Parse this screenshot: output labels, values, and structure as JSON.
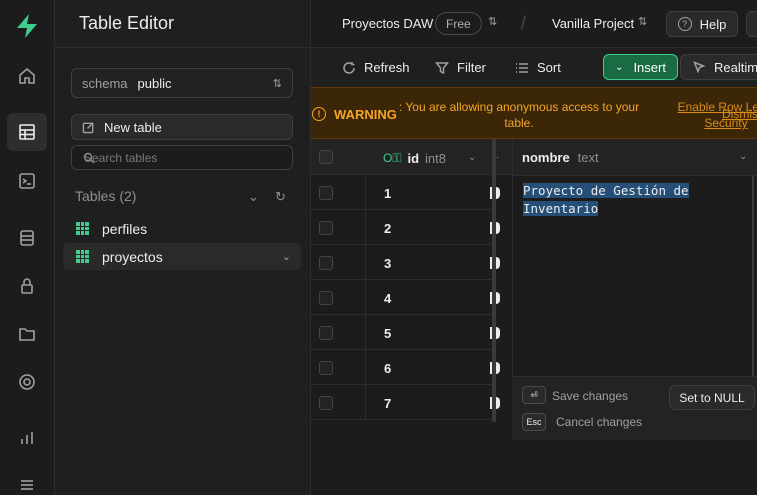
{
  "sidebar": {
    "title": "Table Editor",
    "schema_label": "schema",
    "schema_value": "public",
    "new_table_label": "New table",
    "search_placeholder": "Search tables",
    "tables_heading": "Tables (2)",
    "tables": [
      {
        "name": "perfiles",
        "selected": false
      },
      {
        "name": "proyectos",
        "selected": true
      }
    ]
  },
  "rail": {
    "icons": [
      "home-icon",
      "table-editor-icon",
      "sql-editor-icon",
      "database-icon",
      "auth-icon",
      "storage-icon",
      "realtime-icon",
      "reports-icon",
      "logs-icon"
    ],
    "active": "table-editor-icon",
    "accent": "#3ecf8e"
  },
  "topbar": {
    "project": "Proyectos DAW",
    "plan": "Free",
    "separator": "/",
    "branch": "Vanilla Project",
    "help_label": "Help"
  },
  "toolbar": {
    "refresh_label": "Refresh",
    "filter_label": "Filter",
    "sort_label": "Sort",
    "insert_label": "Insert",
    "realtime_label": "Realtime"
  },
  "warning": {
    "title": "WARNING",
    "message": ": You are allowing anonymous access to your table.",
    "link": "Enable Row Level Security",
    "dismiss": "Dismiss",
    "color": "#f5a524"
  },
  "grid": {
    "id_column": {
      "name": "id",
      "type": "int8"
    },
    "rows": [
      "1",
      "2",
      "3",
      "4",
      "5",
      "6",
      "7"
    ]
  },
  "editor": {
    "column_name": "nombre",
    "column_type": "text",
    "value": "Proyecto de Gestión de Inventario",
    "save_key": "⏎",
    "save_label": "Save changes",
    "cancel_key": "Esc",
    "cancel_label": "Cancel changes",
    "set_null_label": "Set to NULL"
  }
}
